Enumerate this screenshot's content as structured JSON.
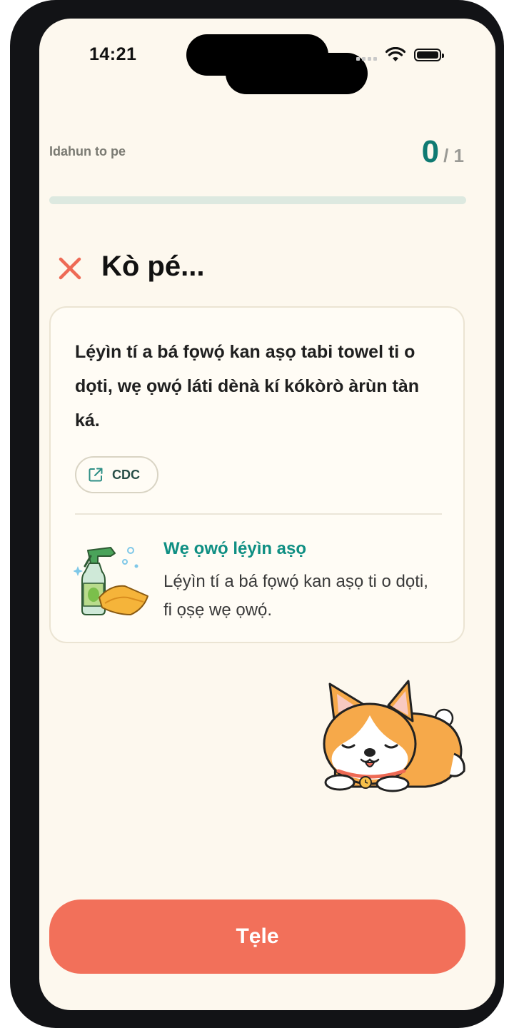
{
  "status_bar": {
    "time": "14:21"
  },
  "progress": {
    "label": "Idahun to pe",
    "current": "0",
    "total": "/ 1",
    "fraction": 0.0
  },
  "result": {
    "title": "Kò pé...",
    "icon": "close-icon"
  },
  "fact_card": {
    "text": "Lẹ́yìn tí a bá fọwọ́ kan aṣọ tabi towel ti o dọti, wẹ ọwọ́ láti dènà kí kókòrò àrùn tàn ká.",
    "source": {
      "label": "CDC",
      "icon": "external-link-icon"
    },
    "tip": {
      "title": "Wẹ ọwọ́ lẹ́yìn aṣọ",
      "body": "Lẹ́yìn tí a bá fọwọ́ kan aṣọ ti o dọti, fi ọṣẹ wẹ ọwọ́.",
      "icon": "cleaning-spray-and-sponge-icon"
    }
  },
  "mascot": {
    "icon": "sleeping-corgi-icon"
  },
  "primary_action": {
    "label": "Tẹle"
  },
  "colors": {
    "accent": "#0f7a72",
    "tip_title": "#0f8f83",
    "button": "#f2705a",
    "error": "#ee6a55",
    "background": "#fdf8ee"
  }
}
